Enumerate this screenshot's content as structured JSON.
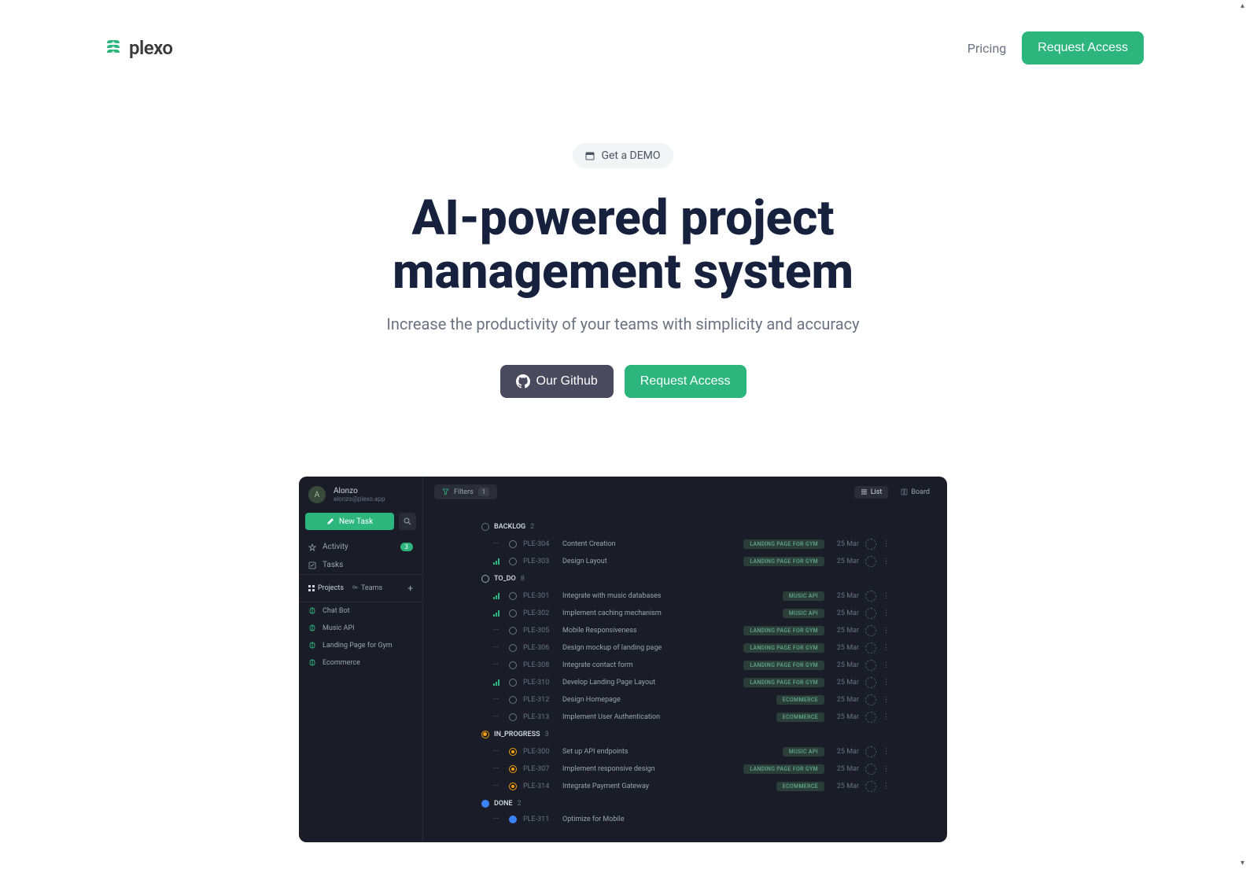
{
  "header": {
    "logo_text": "plexo",
    "pricing": "Pricing",
    "request_access": "Request Access"
  },
  "hero": {
    "demo_label": "Get a DEMO",
    "title": "AI-powered project management system",
    "subtitle": "Increase the productivity of your teams with simplicity and accuracy",
    "github_label": "Our Github",
    "request_access": "Request Access"
  },
  "app": {
    "user": {
      "avatar": "A",
      "name": "Alonzo",
      "email": "alonzo@plexo.app"
    },
    "new_task": "New Task",
    "sidebar": {
      "activity": "Activity",
      "activity_count": "3",
      "tasks": "Tasks",
      "tabs": {
        "projects": "Projects",
        "teams": "Teams"
      }
    },
    "projects": [
      "Chat Bot",
      "Music API",
      "Landing Page for Gym",
      "Ecommerce"
    ],
    "filters_label": "Filters",
    "filters_count": "1",
    "view_list": "List",
    "view_board": "Board",
    "sections": [
      {
        "name": "BACKLOG",
        "status": "backlog",
        "count": "2",
        "tasks": [
          {
            "prio": "none",
            "id": "PLE-304",
            "title": "Content Creation",
            "tag": "LANDING PAGE FOR GYM",
            "tagc": "gym",
            "date": "25 Mar"
          },
          {
            "prio": "bars",
            "id": "PLE-303",
            "title": "Design Layout",
            "tag": "LANDING PAGE FOR GYM",
            "tagc": "gym",
            "date": "25 Mar"
          }
        ]
      },
      {
        "name": "TO_DO",
        "status": "todo",
        "count": "8",
        "tasks": [
          {
            "prio": "bars",
            "id": "PLE-301",
            "title": "Integrate with music databases",
            "tag": "MUSIC API",
            "tagc": "music",
            "date": "25 Mar"
          },
          {
            "prio": "bars",
            "id": "PLE-302",
            "title": "Implement caching mechanism",
            "tag": "MUSIC API",
            "tagc": "music",
            "date": "25 Mar"
          },
          {
            "prio": "none",
            "id": "PLE-305",
            "title": "Mobile Responsiveness",
            "tag": "LANDING PAGE FOR GYM",
            "tagc": "gym",
            "date": "25 Mar"
          },
          {
            "prio": "none",
            "id": "PLE-306",
            "title": "Design mockup of landing page",
            "tag": "LANDING PAGE FOR GYM",
            "tagc": "gym",
            "date": "25 Mar"
          },
          {
            "prio": "none",
            "id": "PLE-308",
            "title": "Integrate contact form",
            "tag": "LANDING PAGE FOR GYM",
            "tagc": "gym",
            "date": "25 Mar"
          },
          {
            "prio": "bars",
            "id": "PLE-310",
            "title": "Develop Landing Page Layout",
            "tag": "LANDING PAGE FOR GYM",
            "tagc": "gym",
            "date": "25 Mar"
          },
          {
            "prio": "none",
            "id": "PLE-312",
            "title": "Design Homepage",
            "tag": "ECOMMERCE",
            "tagc": "ecom",
            "date": "25 Mar"
          },
          {
            "prio": "none",
            "id": "PLE-313",
            "title": "Implement User Authentication",
            "tag": "ECOMMERCE",
            "tagc": "ecom",
            "date": "25 Mar"
          }
        ]
      },
      {
        "name": "IN_PROGRESS",
        "status": "progress",
        "count": "3",
        "tasks": [
          {
            "prio": "none",
            "id": "PLE-300",
            "title": "Set up API endpoints",
            "tag": "MUSIC API",
            "tagc": "music",
            "date": "25 Mar"
          },
          {
            "prio": "none",
            "id": "PLE-307",
            "title": "Implement responsive design",
            "tag": "LANDING PAGE FOR GYM",
            "tagc": "gym",
            "date": "25 Mar"
          },
          {
            "prio": "none",
            "id": "PLE-314",
            "title": "Integrate Payment Gateway",
            "tag": "ECOMMERCE",
            "tagc": "ecom",
            "date": "25 Mar"
          }
        ]
      },
      {
        "name": "DONE",
        "status": "done",
        "count": "2",
        "tasks": [
          {
            "prio": "none",
            "id": "PLE-311",
            "title": "Optimize for Mobile",
            "tag": "",
            "tagc": "",
            "date": ""
          }
        ]
      }
    ]
  }
}
